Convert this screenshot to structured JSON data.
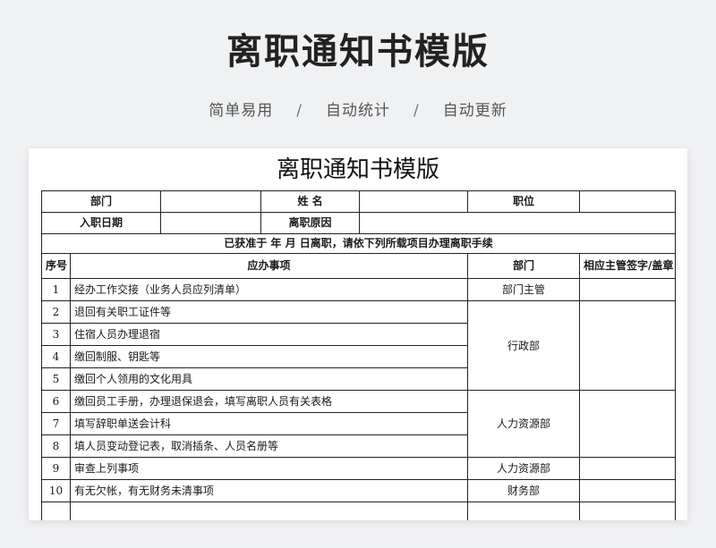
{
  "banner": {
    "title": "离职通知书模版",
    "features": [
      "简单易用",
      "自动统计",
      "自动更新"
    ],
    "separator": "/"
  },
  "sheet": {
    "title": "离职通知书模版",
    "info": {
      "dept_label": "部门",
      "name_label": "姓  名",
      "position_label": "职位",
      "join_label": "入职日期",
      "leave_label": "离职原因"
    },
    "notice": "已获准于  年  月  日离职，请依下列所载项目办理离职手续",
    "headers": {
      "no": "序号",
      "item": "应办事项",
      "dept": "部门",
      "sign": "相应主管签字/盖章"
    },
    "rows": [
      {
        "no": "1",
        "item": "经办工作交接（业务人员应列清单）"
      },
      {
        "no": "2",
        "item": "退回有关职工证件等"
      },
      {
        "no": "3",
        "item": "住宿人员办理退宿"
      },
      {
        "no": "4",
        "item": "缴回制服、钥匙等"
      },
      {
        "no": "5",
        "item": "缴回个人领用的文化用具"
      },
      {
        "no": "6",
        "item": "缴回员工手册，办理退保退会，填写离职人员有关表格"
      },
      {
        "no": "7",
        "item": "填写辞职单送会计科"
      },
      {
        "no": "8",
        "item": "填人员变动登记表，取消插条、人员名册等"
      },
      {
        "no": "9",
        "item": "审查上列事项"
      },
      {
        "no": "10",
        "item": "有无欠帐，有无财务未清事项"
      }
    ],
    "departments": [
      "部门主管",
      "行政部",
      "人力资源部",
      "人力资源部",
      "财务部"
    ]
  }
}
